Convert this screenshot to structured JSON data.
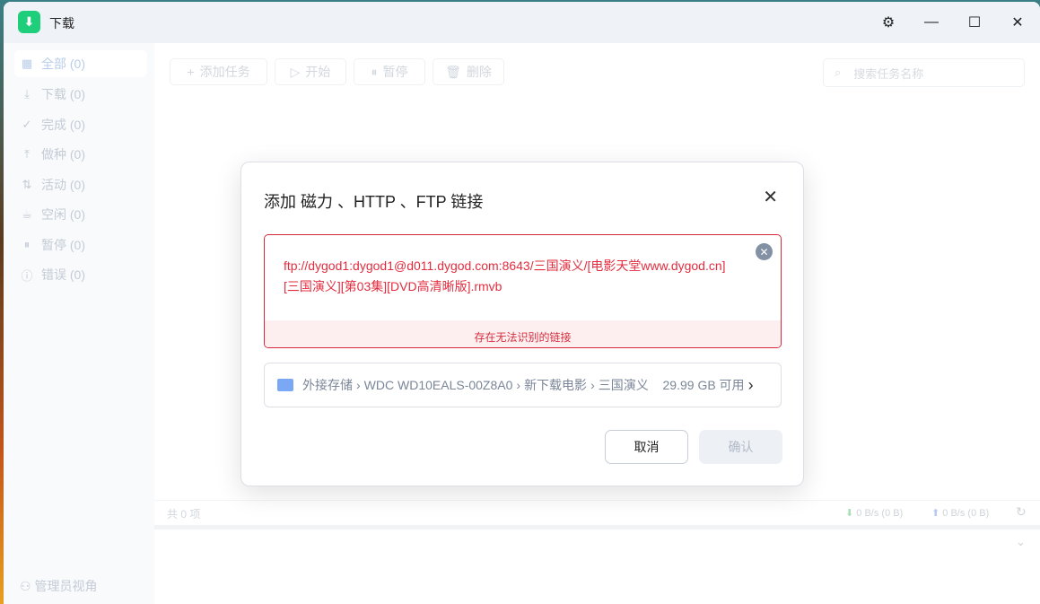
{
  "app": {
    "title": "下载"
  },
  "sidebar": {
    "items": [
      {
        "label": "全部",
        "count": "(0)",
        "icon": "grid-icon"
      },
      {
        "label": "下载",
        "count": "(0)",
        "icon": "download-icon"
      },
      {
        "label": "完成",
        "count": "(0)",
        "icon": "check-circle-icon"
      },
      {
        "label": "做种",
        "count": "(0)",
        "icon": "upload-icon"
      },
      {
        "label": "活动",
        "count": "(0)",
        "icon": "activity-icon"
      },
      {
        "label": "空闲",
        "count": "(0)",
        "icon": "cup-icon"
      },
      {
        "label": "暂停",
        "count": "(0)",
        "icon": "pause-icon"
      },
      {
        "label": "错误",
        "count": "(0)",
        "icon": "error-icon"
      }
    ],
    "admin": "管理员视角"
  },
  "toolbar": {
    "add": "添加任务",
    "start": "开始",
    "pause": "暂停",
    "delete": "删除",
    "search_placeholder": "搜索任务名称"
  },
  "status": {
    "count": "共 0 项",
    "down": "0 B/s (0 B)",
    "up": "0 B/s (0 B)"
  },
  "dialog": {
    "title": "添加 磁力 、HTTP 、FTP 链接",
    "link": "ftp://dygod1:dygod1@d011.dygod.com:8643/三国演义/[电影天堂www.dygod.cn][三国演义][第03集][DVD高清晰版].rmvb",
    "error": "存在无法识别的链接",
    "path": [
      "外接存储",
      "WDC WD10EALS-00Z8A0",
      "新下载电影",
      "三国演义"
    ],
    "free": "29.99 GB 可用",
    "cancel": "取消",
    "confirm": "确认"
  }
}
